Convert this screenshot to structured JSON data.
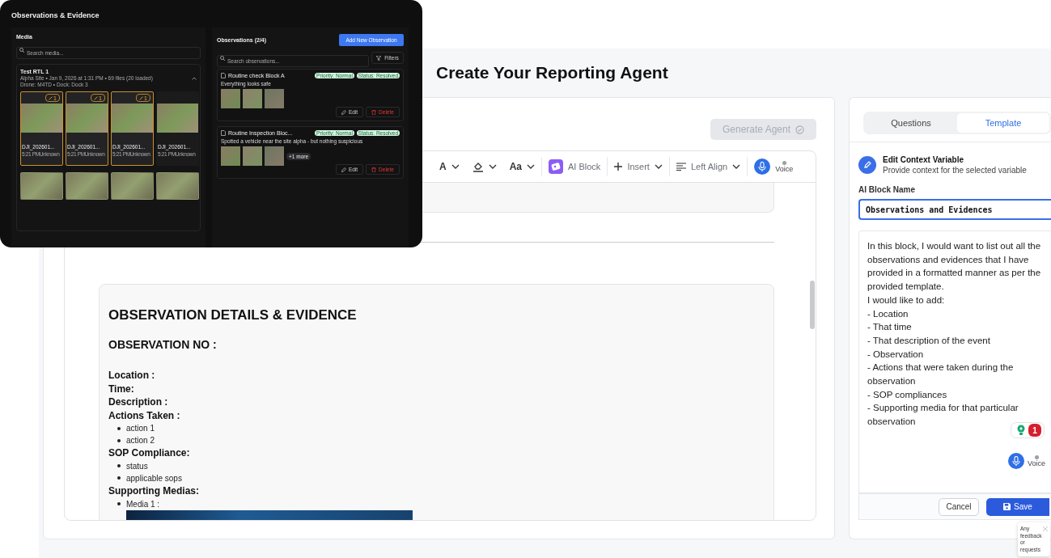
{
  "page": {
    "title": "Create Your Reporting Agent"
  },
  "editor": {
    "generate_button": {
      "label": "Generate Agent",
      "disabled": true
    },
    "toolbar": [
      {
        "kind": "font-color",
        "label": "A"
      },
      {
        "kind": "highlight"
      },
      {
        "kind": "font-size",
        "label": "Aa"
      },
      {
        "kind": "ai-block",
        "label": "AI Block"
      },
      {
        "kind": "insert",
        "label": "Insert"
      },
      {
        "kind": "align",
        "label": "Left Align"
      },
      {
        "kind": "voice",
        "label": "Voice"
      }
    ],
    "document": {
      "heading": "OBSERVATION DETAILS & EVIDENCE",
      "subheading": "OBSERVATION NO :",
      "lines": [
        {
          "kind": "label",
          "text": "Location :"
        },
        {
          "kind": "label",
          "text": "Time:"
        },
        {
          "kind": "label",
          "text": "Description :"
        },
        {
          "kind": "label",
          "text": "Actions Taken :"
        },
        {
          "kind": "bullet",
          "text": "action 1"
        },
        {
          "kind": "bullet",
          "text": "action 2"
        },
        {
          "kind": "label",
          "text": "SOP Compliance:"
        },
        {
          "kind": "bullet",
          "text": "status"
        },
        {
          "kind": "bullet",
          "text": "applicable sops"
        },
        {
          "kind": "label",
          "text": "Supporting Medias:"
        },
        {
          "kind": "bullet",
          "text": "Media 1 :"
        },
        {
          "kind": "image"
        }
      ]
    }
  },
  "side_panel": {
    "tabs": [
      {
        "label": "Questions",
        "selected": false
      },
      {
        "label": "Template",
        "selected": true
      }
    ],
    "context": {
      "title": "Edit Context Variable",
      "subtitle": "Provide context for the selected variable"
    },
    "name_label": "AI Block Name",
    "name_value": "Observations and Evidences",
    "prompt": [
      "In this block, I would want to list out all the observations and evidences that I have provided in a formatted manner as per the provided template.",
      "I would like to add:",
      "- Location",
      "- That time",
      "- That description of the event",
      "- Observation",
      "- Actions that were taken during the observation",
      "- SOP compliances",
      "- Supporting media for that particular observation"
    ],
    "notification_count": "1",
    "voice_label": "Voice",
    "cancel": "Cancel",
    "save": "Save",
    "feedback_tooltip": "Any feedback or requests"
  },
  "overlay": {
    "title": "Observations & Evidence",
    "media": {
      "title": "Media",
      "search_placeholder": "Search media...",
      "group": {
        "name": "Test RTL 1",
        "meta": "Alpha Site  •  Jan 9, 2026 at 1:31 PM  •  69 files (20 loaded)",
        "drone": "Drone: M4TD  •  Dock: Dock 3",
        "expanded": true
      },
      "items": [
        {
          "name": "DJI_202601...",
          "time": "5:21 PMUnknown",
          "selected": true,
          "badge": "1"
        },
        {
          "name": "DJI_202601...",
          "time": "5:21 PMUnknown",
          "selected": true,
          "badge": "1"
        },
        {
          "name": "DJI_202601...",
          "time": "5:21 PMUnknown",
          "selected": true,
          "badge": "1"
        },
        {
          "name": "DJI_202601...",
          "time": "5:21 PMUnknown",
          "selected": false
        },
        {
          "selected": false
        },
        {
          "selected": false
        },
        {
          "selected": false
        },
        {
          "selected": false
        }
      ]
    },
    "observations": {
      "title": "Observations (2/4)",
      "add_button": "Add New Observation",
      "search_placeholder": "Search observations...",
      "filters": "Filters",
      "cards": [
        {
          "title": "Routine check Block A",
          "priority": "Priority: Normal",
          "status": "Status: Resolved",
          "description": "Everything looks safe",
          "edit": "Edit",
          "delete": "Delete"
        },
        {
          "title": "Routine Inspection Bloc...",
          "priority": "Priority: Normal",
          "status": "Status: Resolved",
          "description": "Spotted a vehicle near the site alpha - but nothing suspicious",
          "more": "+1 more",
          "edit": "Edit",
          "delete": "Delete"
        }
      ]
    }
  }
}
